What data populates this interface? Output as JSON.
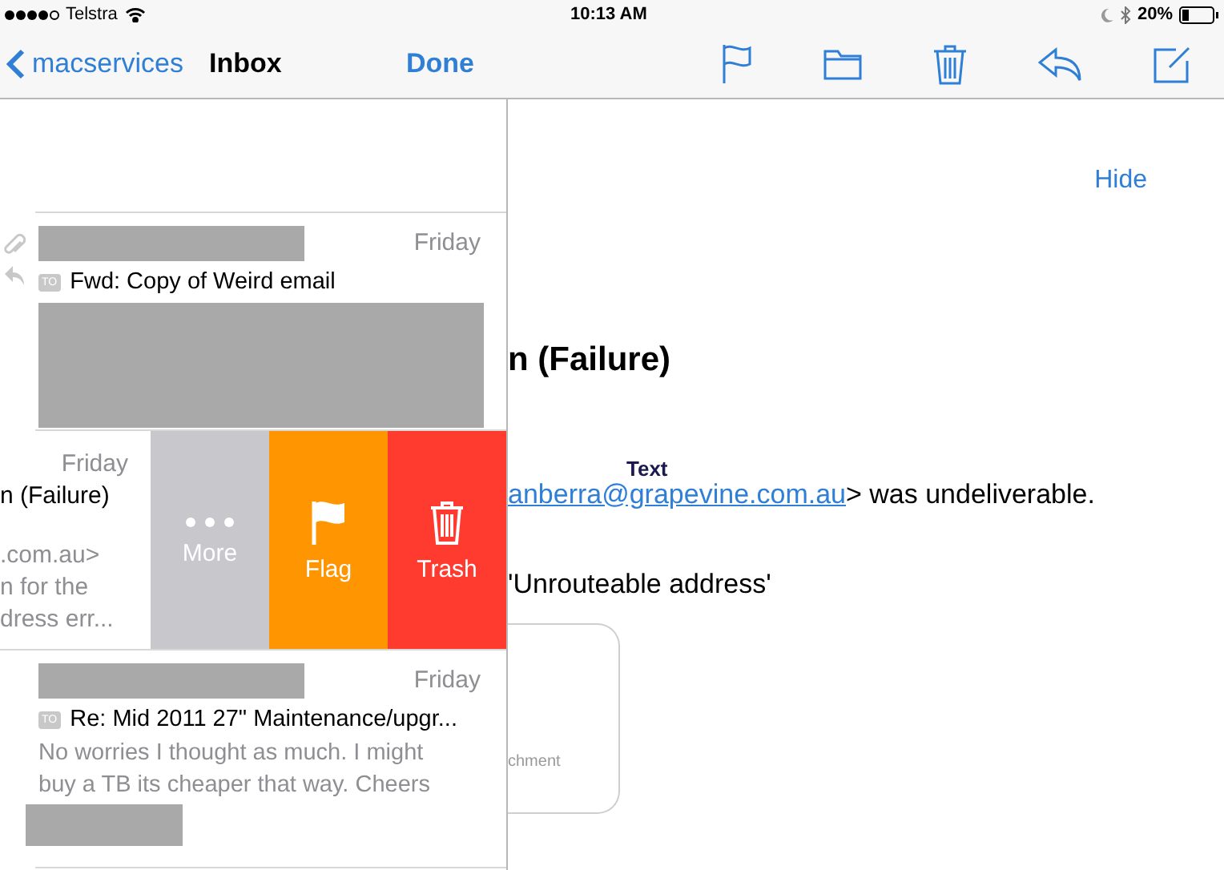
{
  "status_bar": {
    "carrier": "Telstra",
    "time": "10:13 AM",
    "battery": "20%"
  },
  "nav": {
    "back": "macservices",
    "title": "Inbox",
    "done": "Done"
  },
  "messages": [
    {
      "kind": "normal",
      "date": "Friday",
      "badge": "TO",
      "subject": "Fwd: Copy of Weird email",
      "attachment": true,
      "replied": true,
      "redacted_preview": true,
      "redacted_signature": false
    },
    {
      "kind": "swiped",
      "date": "Friday",
      "subject": "n (Failure)",
      "preview": [
        ".com.au>",
        "n for the",
        "dress err..."
      ],
      "actions": [
        {
          "kind": "more",
          "label": "More"
        },
        {
          "kind": "flag",
          "label": "Flag"
        },
        {
          "kind": "trash",
          "label": "Trash"
        }
      ]
    },
    {
      "kind": "normal",
      "date": "Friday",
      "badge": "TO",
      "subject": "Re: Mid 2011 27\" Maintenance/upgr...",
      "attachment": false,
      "replied": false,
      "preview": [
        "No worries I thought as much. I might",
        "buy a TB its cheaper that way. Cheers"
      ],
      "redacted_preview": false,
      "redacted_signature": true
    }
  ],
  "detail": {
    "hide": "Hide",
    "heading": "n (Failure)",
    "link": "anberra@grapevine.com.au",
    "line_rest": "> was undeliverable.",
    "overlay_label": "Text",
    "reason": "'Unrouteable address'",
    "attachment_label": "chment"
  }
}
